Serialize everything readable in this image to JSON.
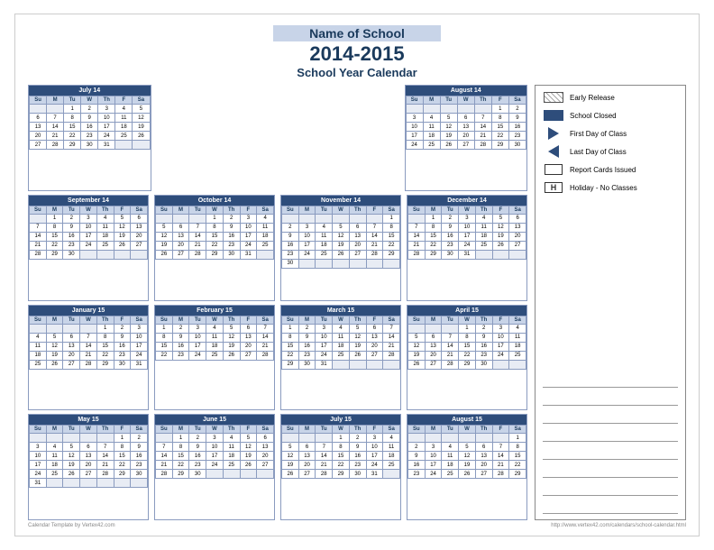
{
  "header": {
    "school_name": "Name of School",
    "year": "2014-2015",
    "subtitle": "School Year Calendar"
  },
  "legend": {
    "items": [
      {
        "label": "Early Release",
        "type": "hatch"
      },
      {
        "label": "School Closed",
        "type": "solid"
      },
      {
        "label": "First Day of Class",
        "type": "triangle-right"
      },
      {
        "label": "Last Day of Class",
        "type": "triangle-left"
      },
      {
        "label": "Report Cards Issued",
        "type": "outline"
      },
      {
        "label": "Holiday - No Classes",
        "type": "h"
      }
    ]
  },
  "footer": {
    "left": "Calendar Template by Vertex42.com",
    "right": "http://www.vertex42.com/calendars/school-calendar.html"
  },
  "months": [
    {
      "name": "July 14",
      "days": [
        "Su",
        "M",
        "Tu",
        "W",
        "Th",
        "F",
        "Sa"
      ],
      "weeks": [
        [
          "",
          "",
          "1",
          "2",
          "3",
          "4",
          "5"
        ],
        [
          "6",
          "7",
          "8",
          "9",
          "10",
          "11",
          "12"
        ],
        [
          "13",
          "14",
          "15",
          "16",
          "17",
          "18",
          "19"
        ],
        [
          "20",
          "21",
          "22",
          "23",
          "24",
          "25",
          "26"
        ],
        [
          "27",
          "28",
          "29",
          "30",
          "31",
          "",
          ""
        ]
      ]
    },
    {
      "name": "August 14",
      "days": [
        "Su",
        "M",
        "Tu",
        "W",
        "Th",
        "F",
        "Sa"
      ],
      "weeks": [
        [
          "",
          "",
          "",
          "",
          "",
          "1",
          "2"
        ],
        [
          "3",
          "4",
          "5",
          "6",
          "7",
          "8",
          "9"
        ],
        [
          "10",
          "11",
          "12",
          "13",
          "14",
          "15",
          "16"
        ],
        [
          "17",
          "18",
          "19",
          "20",
          "21",
          "22",
          "23"
        ],
        [
          "24",
          "25",
          "26",
          "27",
          "28",
          "29",
          "30"
        ]
      ]
    },
    {
      "name": "September 14",
      "days": [
        "Su",
        "M",
        "Tu",
        "W",
        "Th",
        "F",
        "Sa"
      ],
      "weeks": [
        [
          "",
          "1",
          "2",
          "3",
          "4",
          "5",
          "6"
        ],
        [
          "7",
          "8",
          "9",
          "10",
          "11",
          "12",
          "13"
        ],
        [
          "14",
          "15",
          "16",
          "17",
          "18",
          "19",
          "20"
        ],
        [
          "21",
          "22",
          "23",
          "24",
          "25",
          "26",
          "27"
        ],
        [
          "28",
          "29",
          "30",
          "",
          "",
          "",
          ""
        ]
      ]
    },
    {
      "name": "October 14",
      "days": [
        "Su",
        "M",
        "Tu",
        "W",
        "Th",
        "F",
        "Sa"
      ],
      "weeks": [
        [
          "",
          "",
          "",
          "1",
          "2",
          "3",
          "4"
        ],
        [
          "5",
          "6",
          "7",
          "8",
          "9",
          "10",
          "11"
        ],
        [
          "12",
          "13",
          "14",
          "15",
          "16",
          "17",
          "18"
        ],
        [
          "19",
          "20",
          "21",
          "22",
          "23",
          "24",
          "25"
        ],
        [
          "26",
          "27",
          "28",
          "29",
          "30",
          "31",
          ""
        ]
      ]
    },
    {
      "name": "November 14",
      "days": [
        "Su",
        "M",
        "Tu",
        "W",
        "Th",
        "F",
        "Sa"
      ],
      "weeks": [
        [
          "",
          "",
          "",
          "",
          "",
          "",
          "1"
        ],
        [
          "2",
          "3",
          "4",
          "5",
          "6",
          "7",
          "8"
        ],
        [
          "9",
          "10",
          "11",
          "12",
          "13",
          "14",
          "15"
        ],
        [
          "16",
          "17",
          "18",
          "19",
          "20",
          "21",
          "22"
        ],
        [
          "23",
          "24",
          "25",
          "26",
          "27",
          "28",
          "29"
        ],
        [
          "30",
          "",
          "",
          "",
          "",
          "",
          ""
        ]
      ]
    },
    {
      "name": "December 14",
      "days": [
        "Su",
        "M",
        "Tu",
        "W",
        "Th",
        "F",
        "Sa"
      ],
      "weeks": [
        [
          "",
          "1",
          "2",
          "3",
          "4",
          "5",
          "6"
        ],
        [
          "7",
          "8",
          "9",
          "10",
          "11",
          "12",
          "13"
        ],
        [
          "14",
          "15",
          "16",
          "17",
          "18",
          "19",
          "20"
        ],
        [
          "21",
          "22",
          "23",
          "24",
          "25",
          "26",
          "27"
        ],
        [
          "28",
          "29",
          "30",
          "31",
          "",
          "",
          ""
        ]
      ]
    },
    {
      "name": "January 15",
      "days": [
        "Su",
        "M",
        "Tu",
        "W",
        "Th",
        "F",
        "Sa"
      ],
      "weeks": [
        [
          "",
          "",
          "",
          "",
          "1",
          "2",
          "3"
        ],
        [
          "4",
          "5",
          "6",
          "7",
          "8",
          "9",
          "10"
        ],
        [
          "11",
          "12",
          "13",
          "14",
          "15",
          "16",
          "17"
        ],
        [
          "18",
          "19",
          "20",
          "21",
          "22",
          "23",
          "24"
        ],
        [
          "25",
          "26",
          "27",
          "28",
          "29",
          "30",
          "31"
        ]
      ]
    },
    {
      "name": "February 15",
      "days": [
        "Su",
        "M",
        "Tu",
        "W",
        "Th",
        "F",
        "Sa"
      ],
      "weeks": [
        [
          "1",
          "2",
          "3",
          "4",
          "5",
          "6",
          "7"
        ],
        [
          "8",
          "9",
          "10",
          "11",
          "12",
          "13",
          "14"
        ],
        [
          "15",
          "16",
          "17",
          "18",
          "19",
          "20",
          "21"
        ],
        [
          "22",
          "23",
          "24",
          "25",
          "26",
          "27",
          "28"
        ]
      ]
    },
    {
      "name": "March 15",
      "days": [
        "Su",
        "M",
        "Tu",
        "W",
        "Th",
        "F",
        "Sa"
      ],
      "weeks": [
        [
          "1",
          "2",
          "3",
          "4",
          "5",
          "6",
          "7"
        ],
        [
          "8",
          "9",
          "10",
          "11",
          "12",
          "13",
          "14"
        ],
        [
          "15",
          "16",
          "17",
          "18",
          "19",
          "20",
          "21"
        ],
        [
          "22",
          "23",
          "24",
          "25",
          "26",
          "27",
          "28"
        ],
        [
          "29",
          "30",
          "31",
          "",
          "",
          "",
          ""
        ]
      ]
    },
    {
      "name": "April 15",
      "days": [
        "Su",
        "M",
        "Tu",
        "W",
        "Th",
        "F",
        "Sa"
      ],
      "weeks": [
        [
          "",
          "",
          "",
          "1",
          "2",
          "3",
          "4"
        ],
        [
          "5",
          "6",
          "7",
          "8",
          "9",
          "10",
          "11"
        ],
        [
          "12",
          "13",
          "14",
          "15",
          "16",
          "17",
          "18"
        ],
        [
          "19",
          "20",
          "21",
          "22",
          "23",
          "24",
          "25"
        ],
        [
          "26",
          "27",
          "28",
          "29",
          "30",
          "",
          ""
        ]
      ]
    },
    {
      "name": "May 15",
      "days": [
        "Su",
        "M",
        "Tu",
        "W",
        "Th",
        "F",
        "Sa"
      ],
      "weeks": [
        [
          "",
          "",
          "",
          "",
          "",
          "1",
          "2"
        ],
        [
          "3",
          "4",
          "5",
          "6",
          "7",
          "8",
          "9"
        ],
        [
          "10",
          "11",
          "12",
          "13",
          "14",
          "15",
          "16"
        ],
        [
          "17",
          "18",
          "19",
          "20",
          "21",
          "22",
          "23"
        ],
        [
          "24",
          "25",
          "26",
          "27",
          "28",
          "29",
          "30"
        ],
        [
          "31",
          "",
          "",
          "",
          "",
          "",
          ""
        ]
      ]
    },
    {
      "name": "June 15",
      "days": [
        "Su",
        "M",
        "Tu",
        "W",
        "Th",
        "F",
        "Sa"
      ],
      "weeks": [
        [
          "",
          "1",
          "2",
          "3",
          "4",
          "5",
          "6"
        ],
        [
          "7",
          "8",
          "9",
          "10",
          "11",
          "12",
          "13"
        ],
        [
          "14",
          "15",
          "16",
          "17",
          "18",
          "19",
          "20"
        ],
        [
          "21",
          "22",
          "23",
          "24",
          "25",
          "26",
          "27"
        ],
        [
          "28",
          "29",
          "30",
          "",
          "",
          "",
          ""
        ]
      ]
    },
    {
      "name": "July 15",
      "days": [
        "Su",
        "M",
        "Tu",
        "W",
        "Th",
        "F",
        "Sa"
      ],
      "weeks": [
        [
          "",
          "",
          "",
          "1",
          "2",
          "3",
          "4"
        ],
        [
          "5",
          "6",
          "7",
          "8",
          "9",
          "10",
          "11"
        ],
        [
          "12",
          "13",
          "14",
          "15",
          "16",
          "17",
          "18"
        ],
        [
          "19",
          "20",
          "21",
          "22",
          "23",
          "24",
          "25"
        ],
        [
          "26",
          "27",
          "28",
          "29",
          "30",
          "31",
          ""
        ]
      ]
    },
    {
      "name": "August 15",
      "days": [
        "Su",
        "M",
        "Tu",
        "W",
        "Th",
        "F",
        "Sa"
      ],
      "weeks": [
        [
          "",
          "",
          "",
          "",
          "",
          "",
          "1"
        ],
        [
          "2",
          "3",
          "4",
          "5",
          "6",
          "7",
          "8"
        ],
        [
          "9",
          "10",
          "11",
          "12",
          "13",
          "14",
          "15"
        ],
        [
          "16",
          "17",
          "18",
          "19",
          "20",
          "21",
          "22"
        ],
        [
          "23",
          "24",
          "25",
          "26",
          "27",
          "28",
          "29"
        ]
      ]
    }
  ]
}
